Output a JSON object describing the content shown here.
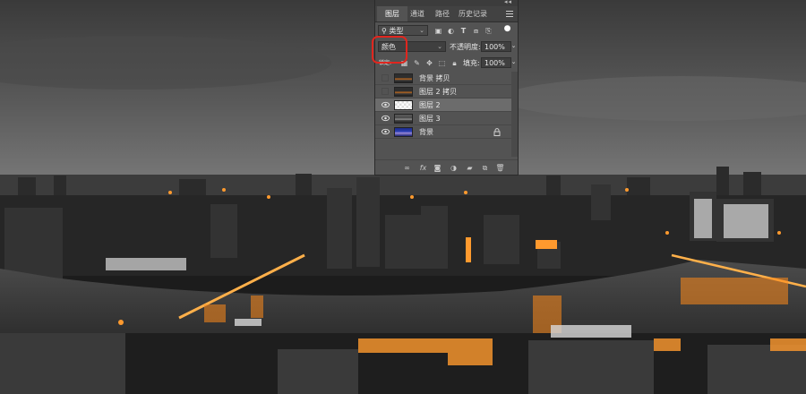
{
  "panel": {
    "tabs": [
      {
        "label": "图层",
        "active": true
      },
      {
        "label": "通道",
        "active": false
      },
      {
        "label": "路径",
        "active": false
      },
      {
        "label": "历史记录",
        "active": false
      }
    ],
    "filter": {
      "kind_label": "类型"
    },
    "blend_mode": "颜色",
    "opacity": {
      "label": "不透明度:",
      "value": "100%"
    },
    "lock": {
      "label": "锁定:"
    },
    "fill": {
      "label": "填充:",
      "value": "100%"
    },
    "layers": [
      {
        "name": "背景 拷贝",
        "visible": false,
        "selected": false,
        "locked": false,
        "thumb": "city"
      },
      {
        "name": "图层 2 拷贝",
        "visible": false,
        "selected": false,
        "locked": false,
        "thumb": "city"
      },
      {
        "name": "图层 2",
        "visible": true,
        "selected": true,
        "locked": false,
        "thumb": "transparent"
      },
      {
        "name": "图层 3",
        "visible": true,
        "selected": false,
        "locked": false,
        "thumb": "city-gray"
      },
      {
        "name": "背景",
        "visible": true,
        "selected": false,
        "locked": true,
        "thumb": "blue"
      }
    ],
    "bottom_fx": "fx"
  },
  "colors": {
    "panel_bg": "#535353",
    "selection": "#6c6c6c",
    "highlight_ring": "#e0261e",
    "city_light": "#ff9a2e"
  }
}
